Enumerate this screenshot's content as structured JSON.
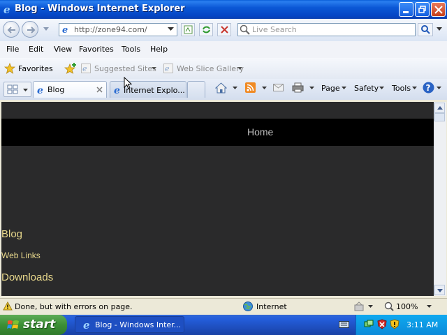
{
  "window": {
    "title": "Blog - Windows Internet Explorer"
  },
  "address": {
    "url": "http://zone94.com/"
  },
  "search": {
    "placeholder": "Live Search"
  },
  "menu": [
    "File",
    "Edit",
    "View",
    "Favorites",
    "Tools",
    "Help"
  ],
  "favorites_bar": {
    "favorites_label": "Favorites",
    "suggested_sites": "Suggested Sites",
    "web_slice_gallery": "Web Slice Gallery"
  },
  "tabs": [
    {
      "label": "Blog",
      "active": true
    },
    {
      "label": "Internet Explo...",
      "active": false
    }
  ],
  "command_bar": {
    "page": "Page",
    "safety": "Safety",
    "tools": "Tools"
  },
  "page": {
    "nav_home": "Home",
    "links": [
      "Blog",
      "Web Links",
      "Downloads"
    ]
  },
  "status": {
    "message": "Done, but with errors on page.",
    "zone": "Internet",
    "zoom": "100%"
  },
  "taskbar": {
    "start_label": "start",
    "task_label": "Blog - Windows Inter...",
    "clock": "3:11 AM"
  },
  "colors": {
    "page_bg": "#2a2a2b",
    "nav_band": "#000000",
    "link_gold": "#e8d88c",
    "titlebar_blue": "#0b58d6"
  }
}
